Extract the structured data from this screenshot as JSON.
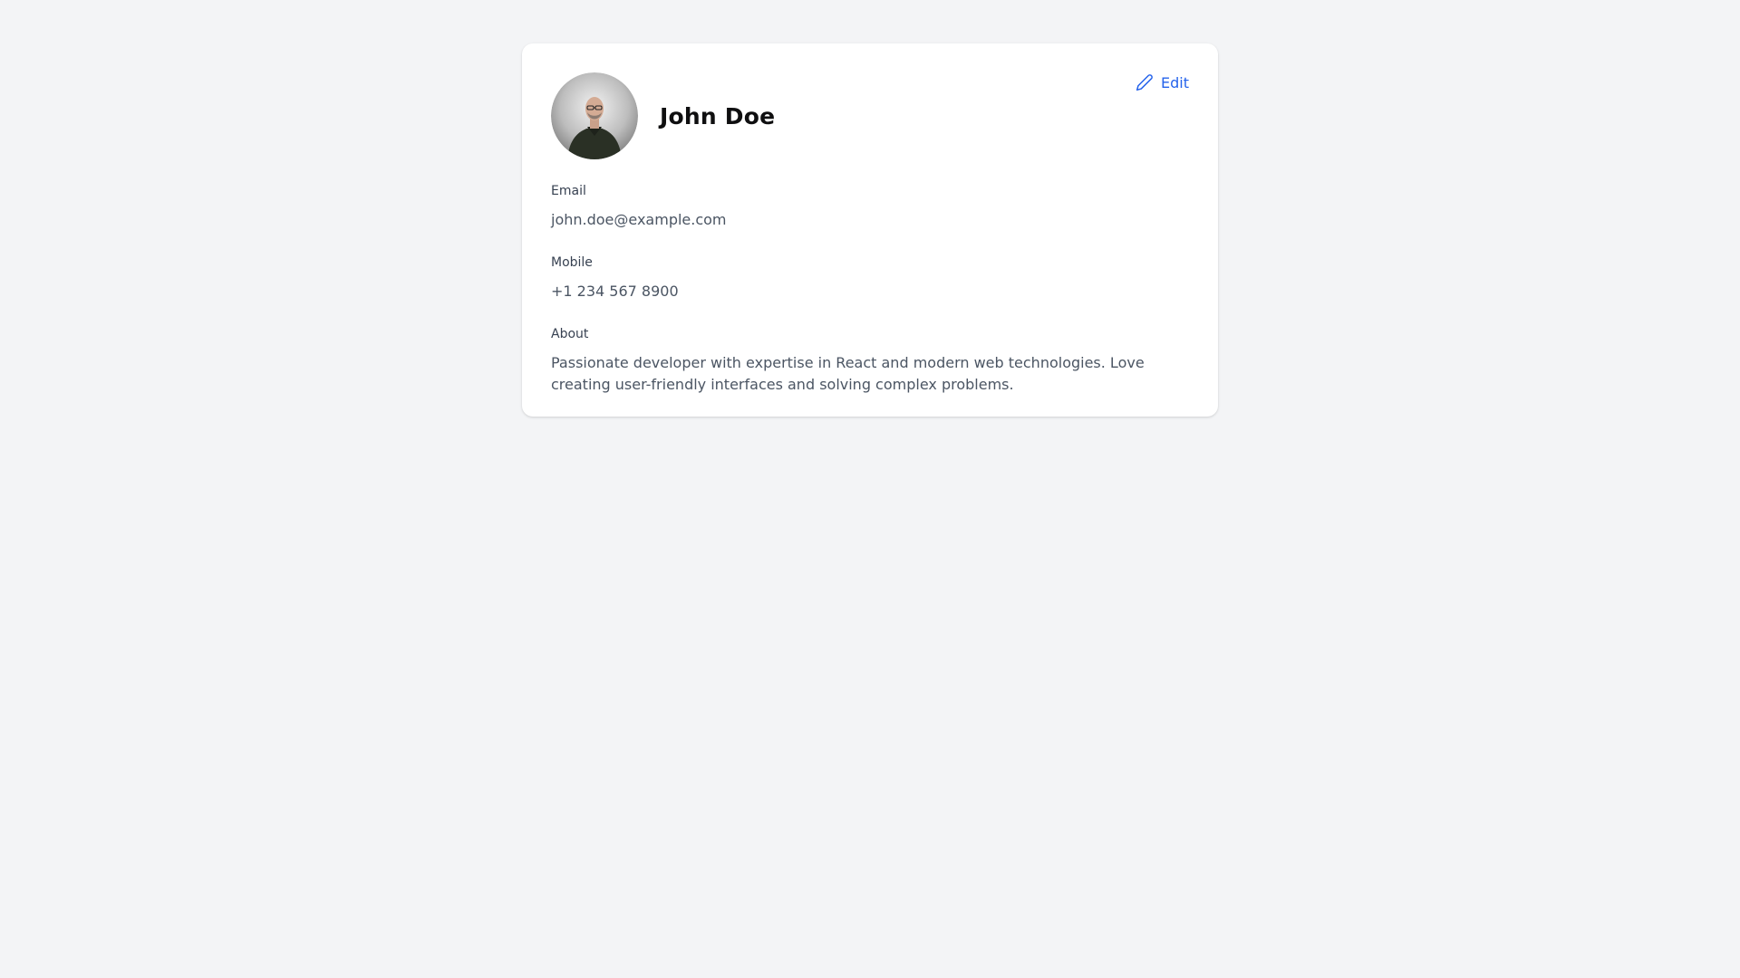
{
  "profile": {
    "name": "John Doe",
    "edit_label": "Edit",
    "avatar_icon": "person-photo",
    "edit_icon": "pencil-icon",
    "fields": [
      {
        "label": "Email",
        "value": "john.doe@example.com"
      },
      {
        "label": "Mobile",
        "value": "+1 234 567 8900"
      },
      {
        "label": "About",
        "value": "Passionate developer with expertise in React and modern web technologies. Love creating user-friendly interfaces and solving complex problems."
      }
    ]
  },
  "colors": {
    "background": "#f3f4f6",
    "card": "#ffffff",
    "accent": "#2563eb",
    "label_text": "#374151",
    "value_text": "#4b5563"
  }
}
